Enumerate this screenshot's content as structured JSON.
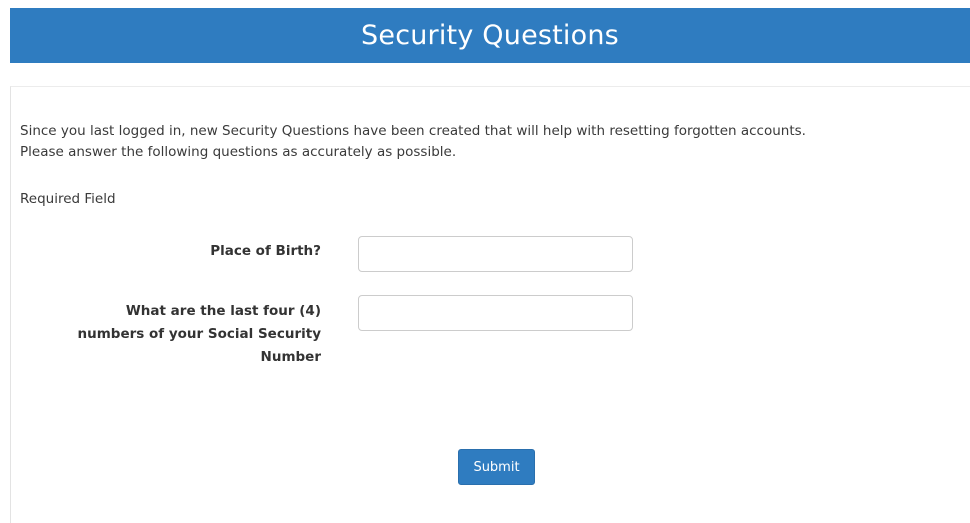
{
  "header": {
    "title": "Security Questions"
  },
  "intro": {
    "line1": "Since you last logged in, new Security Questions have been created that will help with resetting forgotten accounts.",
    "line2": "Please answer the following questions as accurately as possible."
  },
  "required_label": "Required Field",
  "questions": [
    {
      "label_lines": [
        "Place of Birth?"
      ],
      "value": "",
      "placeholder": ""
    },
    {
      "label_lines": [
        "What are the last four (4)",
        "numbers of your Social Security",
        "Number"
      ],
      "value": "",
      "placeholder": ""
    }
  ],
  "submit_label": "Submit",
  "colors": {
    "header_bg": "#2f7cc0",
    "button_bg": "#2f7cc0",
    "text": "#333333"
  }
}
